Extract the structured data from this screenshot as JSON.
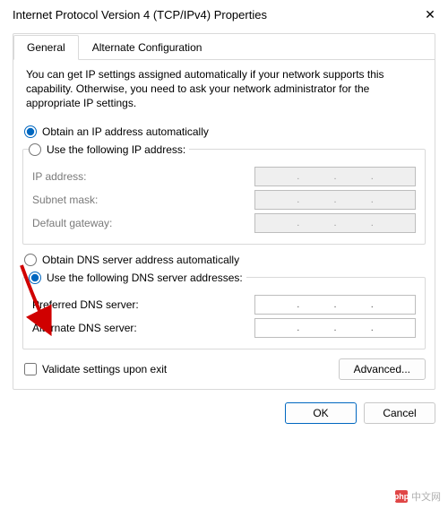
{
  "window": {
    "title": "Internet Protocol Version 4 (TCP/IPv4) Properties",
    "close_glyph": "✕"
  },
  "tabs": {
    "general": "General",
    "alternate": "Alternate Configuration"
  },
  "intro": "You can get IP settings assigned automatically if your network supports this capability. Otherwise, you need to ask your network administrator for the appropriate IP settings.",
  "ip": {
    "auto_label": "Obtain an IP address automatically",
    "manual_label": "Use the following IP address:",
    "address_label": "IP address:",
    "subnet_label": "Subnet mask:",
    "gateway_label": "Default gateway:"
  },
  "dns": {
    "auto_label": "Obtain DNS server address automatically",
    "manual_label": "Use the following DNS server addresses:",
    "preferred_label": "Preferred DNS server:",
    "alternate_label": "Alternate DNS server:"
  },
  "validate_label": "Validate settings upon exit",
  "buttons": {
    "advanced": "Advanced...",
    "ok": "OK",
    "cancel": "Cancel"
  },
  "watermark": "中文网"
}
